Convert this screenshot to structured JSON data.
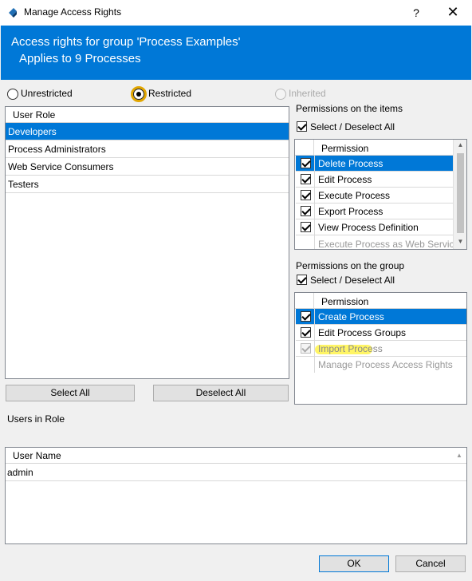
{
  "window": {
    "title": "Manage Access Rights",
    "help_label": "?",
    "close_label": "✕"
  },
  "header": {
    "line1": "Access rights for group 'Process Examples'",
    "line2": "Applies to 9 Processes"
  },
  "mode": {
    "options": [
      "Unrestricted",
      "Restricted",
      "Inherited"
    ],
    "selected": "Restricted",
    "disabled": [
      "Inherited"
    ]
  },
  "roles": {
    "column_header": "User Role",
    "rows": [
      "Developers",
      "Process Administrators",
      "Web Service Consumers",
      "Testers"
    ],
    "selected": "Developers",
    "select_all_label": "Select All",
    "deselect_all_label": "Deselect All"
  },
  "item_permissions": {
    "section_label": "Permissions on the items",
    "select_toggle_label": "Select / Deselect All",
    "column_header": "Permission",
    "rows": [
      {
        "label": "Delete Process",
        "checked": true
      },
      {
        "label": "Edit Process",
        "checked": true
      },
      {
        "label": "Execute Process",
        "checked": true
      },
      {
        "label": "Export Process",
        "checked": true
      },
      {
        "label": "View Process Definition",
        "checked": true
      },
      {
        "label": "Execute Process as Web Service",
        "checked": false
      }
    ],
    "selected": "Delete Process"
  },
  "group_permissions": {
    "section_label": "Permissions on the group",
    "select_toggle_label": "Select / Deselect All",
    "column_header": "Permission",
    "rows": [
      {
        "label": "Create Process",
        "checked": true
      },
      {
        "label": "Edit Process Groups",
        "checked": true
      },
      {
        "label": "Import Process",
        "checked": true
      },
      {
        "label": "Manage Process Access Rights",
        "checked": false
      }
    ],
    "selected": "Create Process"
  },
  "users": {
    "section_label": "Users in Role",
    "column_header": "User Name",
    "rows": [
      "admin"
    ]
  },
  "footer": {
    "ok_label": "OK",
    "cancel_label": "Cancel"
  },
  "colors": {
    "accent": "#0078d7",
    "focus_ring": "#e2a600",
    "highlight": "#fff34a"
  },
  "icons": {
    "app": "app-logo-icon",
    "sort": "sort-up-icon"
  }
}
